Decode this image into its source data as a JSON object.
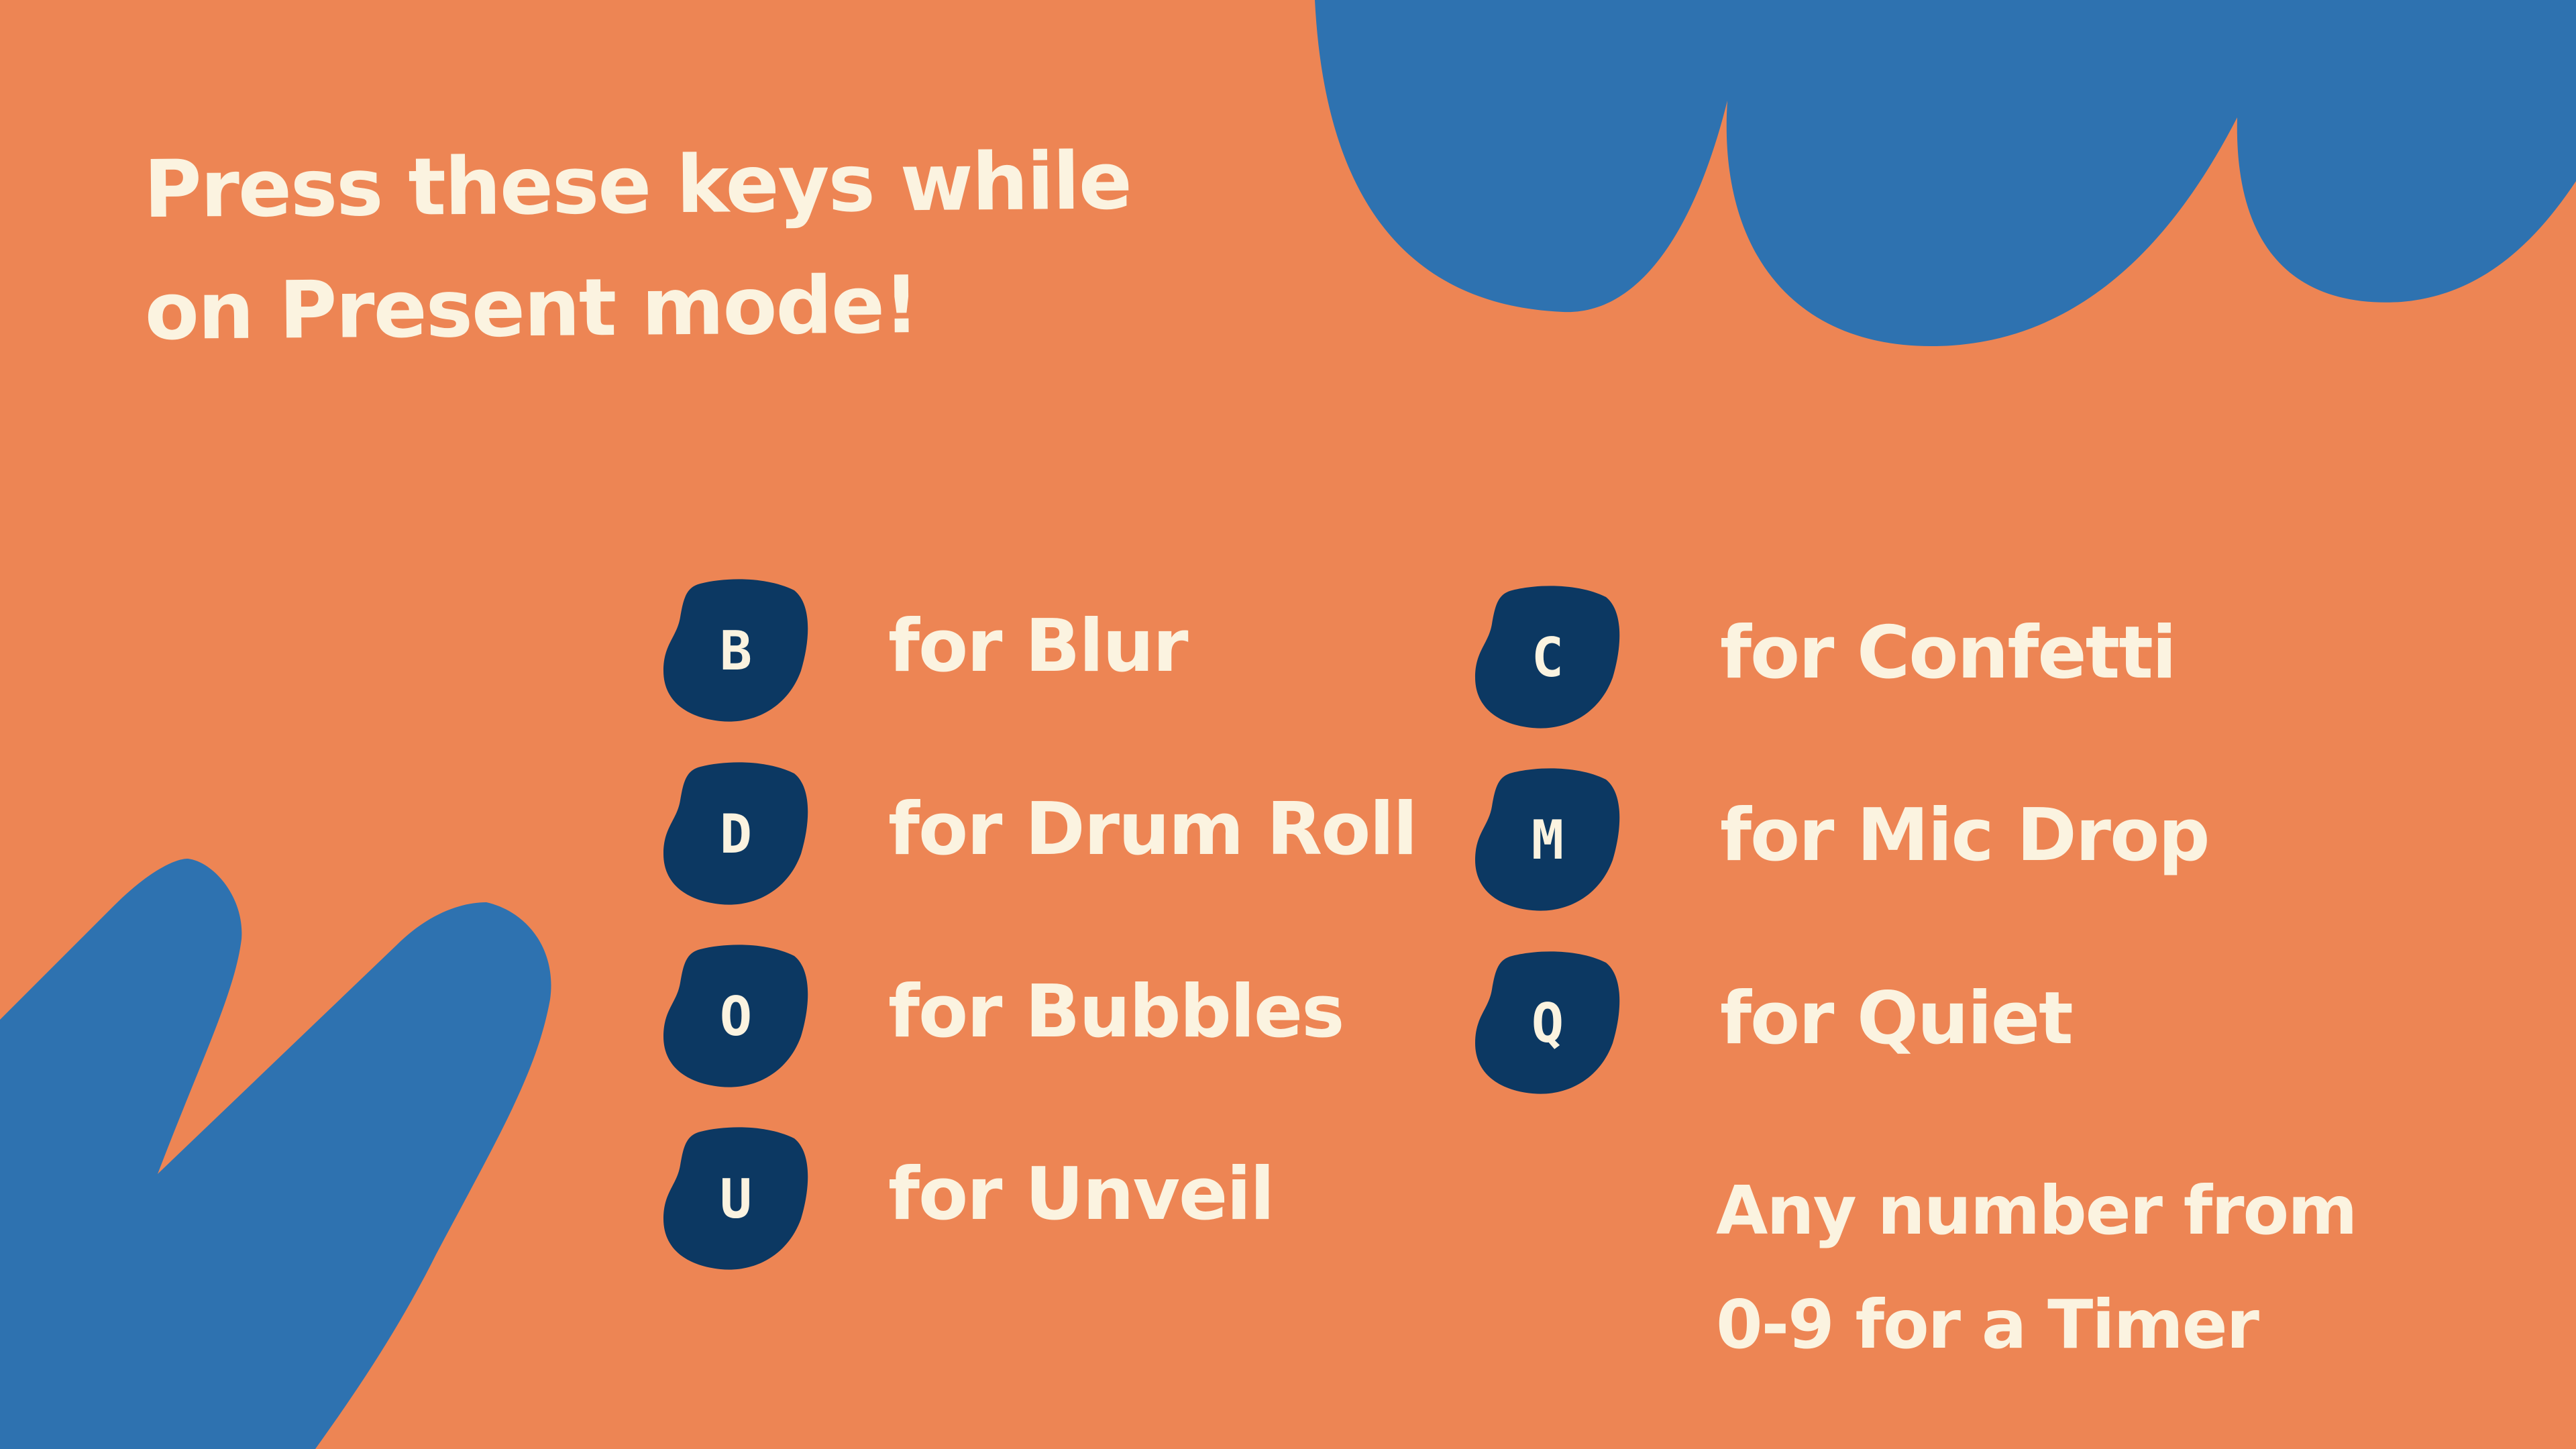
{
  "slide": {
    "background_color": "#ED8554",
    "blob_color": "#2E72B0",
    "badge_color": "#0C3862",
    "text_color": "#FBF3E0",
    "heading_lines": [
      "Press these keys while",
      "on Present mode!"
    ],
    "shortcuts": [
      {
        "key": "B",
        "label": "for Blur"
      },
      {
        "key": "D",
        "label": "for Drum Roll"
      },
      {
        "key": "O",
        "label": "for Bubbles"
      },
      {
        "key": "U",
        "label": "for Unveil"
      },
      {
        "key": "C",
        "label": "for Confetti"
      },
      {
        "key": "M",
        "label": "for Mic Drop"
      },
      {
        "key": "Q",
        "label": "for Quiet"
      }
    ],
    "note_lines": [
      "Any number from",
      "0-9 for a Timer"
    ]
  }
}
